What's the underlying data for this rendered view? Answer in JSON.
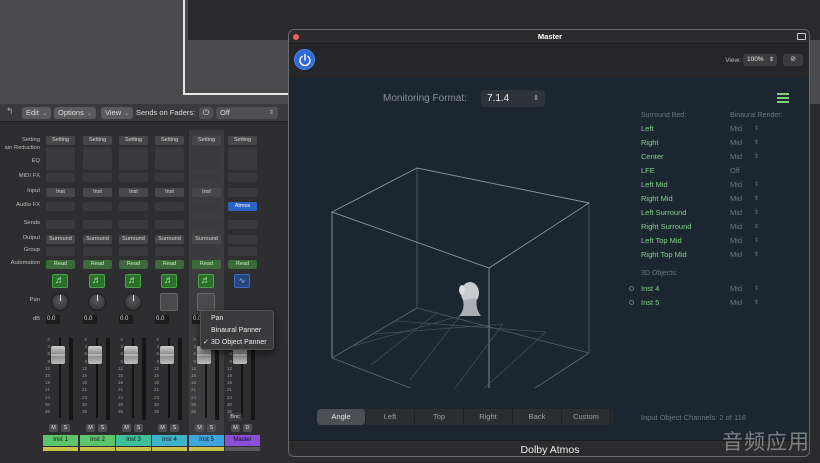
{
  "mixer_toolbar": {
    "edit": "Edit",
    "options": "Options",
    "view": "View",
    "sends_on_faders": "Sends on Faders:",
    "sends_value": "Off"
  },
  "row_labels": {
    "setting": "Setting",
    "gain_reduction": "ain Reduction",
    "eq": "EQ",
    "midi_fx": "MIDI FX",
    "input": "Input",
    "audio_fx": "Audio FX",
    "sends": "Sends",
    "output": "Output",
    "group": "Group",
    "automation": "Automation",
    "pan": "Pan",
    "db": "dB"
  },
  "strips": [
    {
      "name": "Inst 1",
      "setting": "Setting",
      "input": "Inst",
      "output": "Surround",
      "automation": "Read",
      "db": "0.0",
      "color": "#5cc46a",
      "pan_type": "knob"
    },
    {
      "name": "Inst 2",
      "setting": "Setting",
      "input": "Inst",
      "output": "Surround",
      "automation": "Read",
      "db": "0.0",
      "color": "#5cc46a",
      "pan_type": "knob"
    },
    {
      "name": "Inst 3",
      "setting": "Setting",
      "input": "Inst",
      "output": "Surround",
      "automation": "Read",
      "db": "0.0",
      "color": "#3fbf9a",
      "pan_type": "knob"
    },
    {
      "name": "Inst 4",
      "setting": "Setting",
      "input": "Inst",
      "output": "Surround",
      "automation": "Read",
      "db": "0.0",
      "color": "#3fb2c9",
      "pan_type": "pad"
    },
    {
      "name": "Inst 5",
      "setting": "Setting",
      "input": "Inst",
      "output": "Surround",
      "automation": "Read",
      "db": "0.0",
      "color": "#3ea6dc",
      "pan_type": "pad"
    },
    {
      "name": "Master",
      "setting": "Setting",
      "input": "",
      "output": "",
      "automation": "Read",
      "db": "0.0",
      "color": "#8a4fd6",
      "audio_fx": "Atmos",
      "pan_type": "none"
    }
  ],
  "strip_buttons": {
    "mute": "M",
    "solo": "S",
    "dim": "D",
    "bnc": "Bnc"
  },
  "pan_menu": {
    "items": [
      "Pan",
      "Binaural Panner",
      "3D Object Panner"
    ],
    "checked": "✓"
  },
  "master_window": {
    "title": "Master",
    "view_label": "View:",
    "zoom": "100%",
    "link_icon": "⊘",
    "monitoring_label": "Monitoring Format:",
    "monitoring_value": "7.1.4",
    "surround_bed_header": "Surround Bed:",
    "binaural_header": "Binaural Render:",
    "surround_bed": [
      {
        "name": "Left",
        "mode": "Mid",
        "arrows": true
      },
      {
        "name": "Right",
        "mode": "Mid",
        "arrows": true
      },
      {
        "name": "Center",
        "mode": "Mid",
        "arrows": true
      },
      {
        "name": "LFE",
        "mode": "Off",
        "arrows": false
      },
      {
        "name": "Left Mid",
        "mode": "Mid",
        "arrows": true
      },
      {
        "name": "Right Mid",
        "mode": "Mid",
        "arrows": true
      },
      {
        "name": "Left Surround",
        "mode": "Mid",
        "arrows": true
      },
      {
        "name": "Right Surround",
        "mode": "Mid",
        "arrows": true
      },
      {
        "name": "Left Top Mid",
        "mode": "Mid",
        "arrows": true
      },
      {
        "name": "Right Top Mid",
        "mode": "Mid",
        "arrows": true
      }
    ],
    "objects_header": "3D Objects:",
    "objects": [
      {
        "name": "Inst 4",
        "mode": "Mid"
      },
      {
        "name": "Inst 5",
        "mode": "Mid"
      }
    ],
    "view_tabs": [
      "Angle",
      "Left",
      "Top",
      "Right",
      "Back",
      "Custom"
    ],
    "active_tab": "Angle",
    "input_channels": "Input Object Channels: 2 of 118",
    "footer": "Dolby Atmos",
    "updown_arrow": "⇕"
  },
  "watermark": "音频应用",
  "icons": {
    "power": "power-icon",
    "list": "list-icon",
    "link": "link-icon",
    "note": "♬"
  },
  "colors": {
    "accent_blue": "#2f6ad6",
    "label_green": "#84d18a",
    "read_green": "#3c6a3c"
  }
}
